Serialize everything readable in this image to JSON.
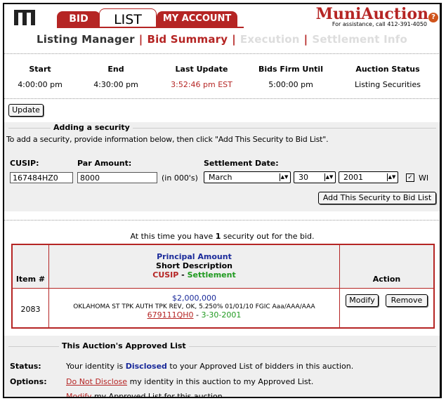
{
  "header": {
    "tabs": {
      "bid": "BID",
      "list": "LIST",
      "account": "MY ACCOUNT"
    },
    "brand": "MuniAuction",
    "assistance": "For assistance, call 412-391-4050",
    "help_symbol": "?"
  },
  "subnav": {
    "items": [
      "Listing Manager",
      "Bid Summary",
      "Execution",
      "Settlement Info"
    ],
    "separator": "|"
  },
  "times": {
    "start": {
      "label": "Start",
      "value": "4:00:00 pm"
    },
    "end": {
      "label": "End",
      "value": "4:30:00 pm"
    },
    "last_update": {
      "label": "Last Update",
      "value": "3:52:46 pm EST"
    },
    "bids_firm": {
      "label": "Bids Firm Until",
      "value": "5:00:00 pm"
    },
    "status": {
      "label": "Auction Status",
      "value": "Listing Securities"
    }
  },
  "update_button": "Update",
  "add_security": {
    "legend": "Adding a security",
    "instructions": "To add a security, provide information below, then click \"Add This Security to Bid List\".",
    "cusip_label": "CUSIP:",
    "cusip_value": "167484HZ0",
    "par_label": "Par Amount:",
    "par_value": "8000",
    "par_unit": "(in 000's)",
    "settlement_label": "Settlement Date:",
    "month": "March",
    "day": "30",
    "year": "2001",
    "wi_label": "WI",
    "wi_checked": true,
    "add_button": "Add This Security to Bid List"
  },
  "summary": {
    "prefix": "At this time you have",
    "count": "1",
    "suffix": "security out for the bid."
  },
  "bid_table": {
    "headers": {
      "item": "Item #",
      "principal": "Principal Amount",
      "short_desc": "Short Description",
      "cusip": "CUSIP",
      "dash": " - ",
      "settlement": "Settlement",
      "action": "Action"
    },
    "rows": [
      {
        "item": "2083",
        "principal": "$2,000,000",
        "description": "OKLAHOMA ST TPK AUTH TPK REV, OK, 5.250% 01/01/10 FGIC Aaa/AAA/AAA",
        "cusip": "679111QH0",
        "dash": " - ",
        "settlement": "3-30-2001",
        "modify": "Modify",
        "remove": "Remove"
      }
    ]
  },
  "approved": {
    "legend": "This Auction's Approved List",
    "status_label": "Status:",
    "status_pre": "Your identity is",
    "status_word": "Disclosed",
    "status_post": "to your Approved List of bidders in this auction.",
    "options_label": "Options:",
    "opt1_link": "Do Not Disclose",
    "opt1_text": "my identity in this auction to my Approved List.",
    "opt2_link": "Modify",
    "opt2_text": "my Approved List for this auction."
  },
  "colors": {
    "brand_red": "#b52524",
    "navy": "#1a2a9a",
    "green": "#1f9a1f"
  }
}
